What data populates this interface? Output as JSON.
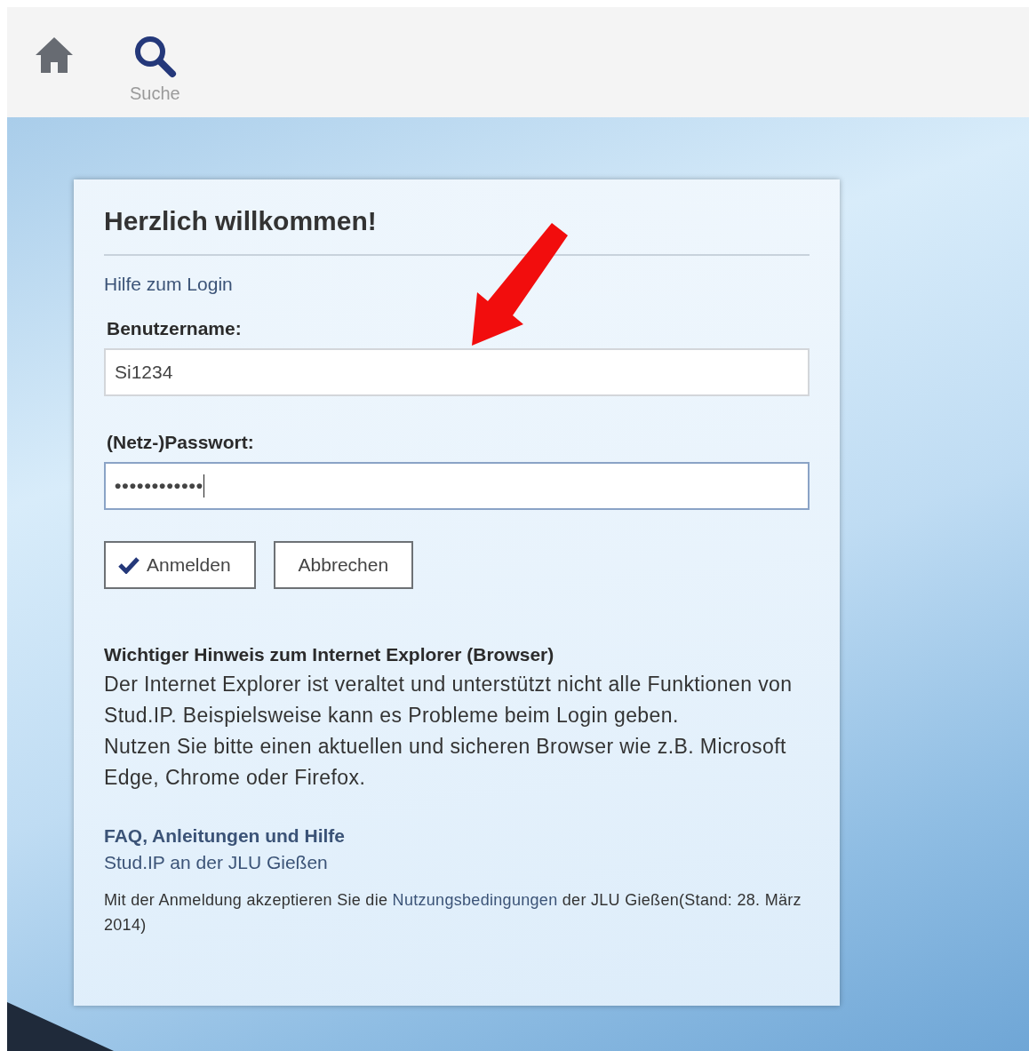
{
  "top_nav": {
    "items": [
      {
        "kind": "home"
      },
      {
        "kind": "search",
        "label": "Suche"
      }
    ]
  },
  "login": {
    "title": "Herzlich willkommen!",
    "help_link": "Hilfe zum Login",
    "fields": [
      {
        "label": "Benutzername:",
        "kind": "text",
        "value": "Si1234",
        "focused": false
      },
      {
        "label": "(Netz-)Passwort:",
        "kind": "password",
        "value": "••••••••••••",
        "focused": true
      }
    ],
    "buttons": [
      {
        "label": "Anmelden",
        "kind": "confirm"
      },
      {
        "label": "Abbrechen",
        "kind": "plain"
      }
    ],
    "notice": {
      "heading": "Wichtiger Hinweis zum Internet Explorer (Browser)",
      "paragraphs": [
        "Der Internet Explorer ist veraltet und unterstützt nicht alle Funktionen von Stud.IP. Beispielsweise kann es Probleme beim Login geben.",
        "Nutzen Sie bitte einen aktuellen und sicheren Browser wie z.B. Microsoft Edge, Chrome oder Firefox."
      ]
    },
    "links": [
      {
        "label": "FAQ, Anleitungen und Hilfe",
        "bold": true
      },
      {
        "label": "Stud.IP an der JLU Gießen",
        "bold": false
      }
    ],
    "terms": {
      "before": "Mit der Anmeldung akzeptieren Sie die",
      "link": "Nutzungsbedingungen",
      "after": "der JLU Gießen(Stand: 28. März 2014)"
    }
  }
}
